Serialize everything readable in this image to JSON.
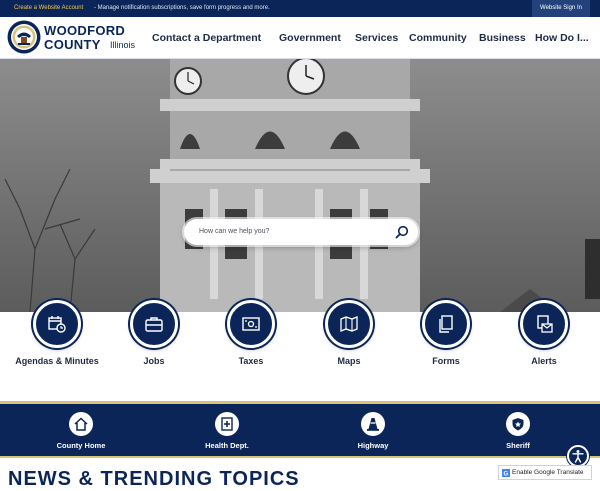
{
  "topbar": {
    "create_link": "Create a Website Account",
    "create_note": "- Manage notification subscriptions, save form progress and more.",
    "signin": "Website Sign In"
  },
  "brand": {
    "line1": "WOODFORD",
    "line2": "COUNTY",
    "state": "Illinois"
  },
  "nav": [
    "Contact a Department",
    "Government",
    "Services",
    "Community",
    "Business",
    "How Do I..."
  ],
  "search": {
    "placeholder": "How can we help you?"
  },
  "quick_links": [
    {
      "label": "Agendas & Minutes",
      "icon": "calendar-clock-icon"
    },
    {
      "label": "Jobs",
      "icon": "briefcase-icon"
    },
    {
      "label": "Taxes",
      "icon": "tax-bill-icon"
    },
    {
      "label": "Maps",
      "icon": "map-pin-icon"
    },
    {
      "label": "Forms",
      "icon": "documents-icon"
    },
    {
      "label": "Alerts",
      "icon": "alert-envelope-icon"
    }
  ],
  "departments": [
    {
      "label": "County Home",
      "icon": "house-icon"
    },
    {
      "label": "Health Dept.",
      "icon": "health-cross-icon"
    },
    {
      "label": "Highway",
      "icon": "traffic-cone-icon"
    },
    {
      "label": "Sheriff",
      "icon": "sheriff-badge-icon"
    }
  ],
  "news_heading": "NEWS & TRENDING TOPICS",
  "translate": {
    "label": "Enable Google Translate"
  },
  "colors": {
    "navy": "#0b2559",
    "gold": "#d9c27a",
    "topbar_link": "#f2c94c"
  }
}
